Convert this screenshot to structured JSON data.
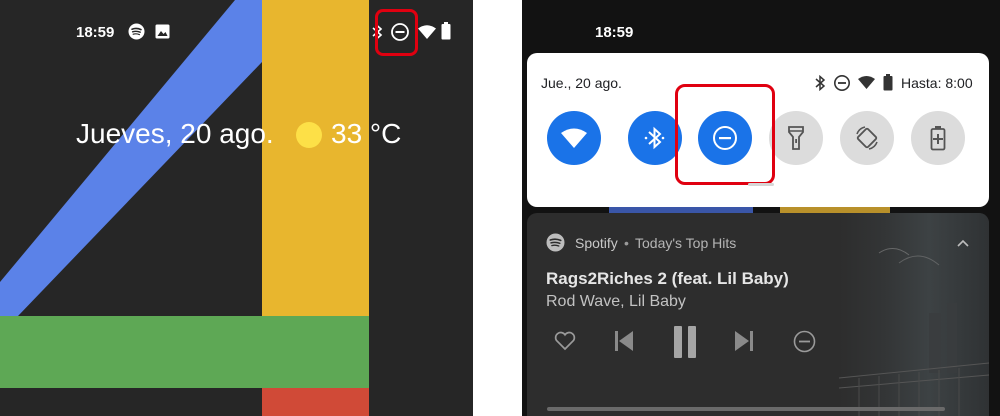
{
  "left_phone": {
    "status_bar": {
      "time": "18:59"
    },
    "widget": {
      "date": "Jueves, 20 ago.",
      "temperature": "33 °C"
    },
    "wallpaper_colors": {
      "background": "#262626",
      "blue": "#5b82e8",
      "yellow": "#e8b62e",
      "green": "#5ea855",
      "red": "#d04a37"
    },
    "highlight": {
      "target": "dnd-status-icon",
      "color": "#e00010"
    }
  },
  "right_phone": {
    "status_bar": {
      "time": "18:59"
    },
    "quick_settings": {
      "date": "Jue., 20 ago.",
      "until": "Hasta: 8:00",
      "tiles": [
        {
          "name": "wifi",
          "state": "on"
        },
        {
          "name": "bluetooth",
          "state": "on"
        },
        {
          "name": "do-not-disturb",
          "state": "on",
          "highlighted": true
        },
        {
          "name": "flashlight",
          "state": "off"
        },
        {
          "name": "auto-rotate",
          "state": "off"
        },
        {
          "name": "battery-saver",
          "state": "off"
        }
      ],
      "accent": "#1a73e8"
    },
    "media": {
      "app": "Spotify",
      "separator": "•",
      "playlist": "Today's Top Hits",
      "title": "Rags2Riches 2 (feat. Lil Baby)",
      "artist": "Rod Wave, Lil Baby",
      "controls": [
        "like",
        "previous",
        "pause",
        "next",
        "block"
      ]
    }
  }
}
